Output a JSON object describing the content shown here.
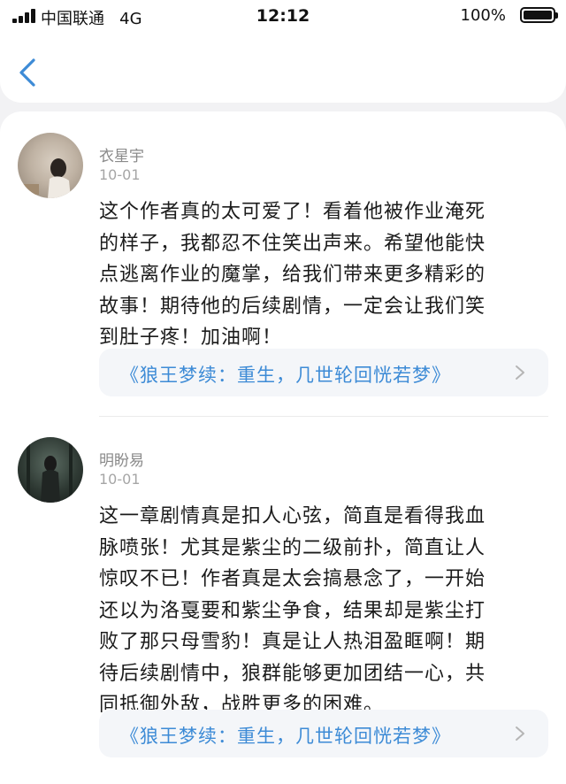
{
  "status_bar": {
    "carrier": "中国联通",
    "network": "4G",
    "time": "12:12",
    "battery": "100%"
  },
  "nav": {
    "back_icon": "chevron-left-icon"
  },
  "comments": [
    {
      "username": "衣星宇",
      "date": "10-01",
      "text": "这个作者真的太可爱了！看着他被作业淹死\n的样子，我都忍不住笑出声来。希望他能快\n点逃离作业的魔掌，给我们带来更多精彩的\n故事！期待他的后续剧情，一定会让我们笑\n到肚子疼！加油啊！",
      "book_title": "《狼王梦续：重生，几世轮回恍若梦》"
    },
    {
      "username": "明盼易",
      "date": "10-01",
      "text": "这一章剧情真是扣人心弦，简直是看得我血\n脉喷张！尤其是紫尘的二级前扑，简直让人\n惊叹不已！作者真是太会搞悬念了，一开始\n还以为洛戛要和紫尘争食，结果却是紫尘打\n败了那只母雪豹！真是让人热泪盈眶啊！期\n待后续剧情中，狼群能够更加团结一心，共\n同抵御外敌，战胜更多的困难。",
      "book_title": "《狼王梦续：重生，几世轮回恍若梦》"
    }
  ],
  "colors": {
    "link": "#3d8bd6",
    "accent_back": "#3d8bd6"
  }
}
